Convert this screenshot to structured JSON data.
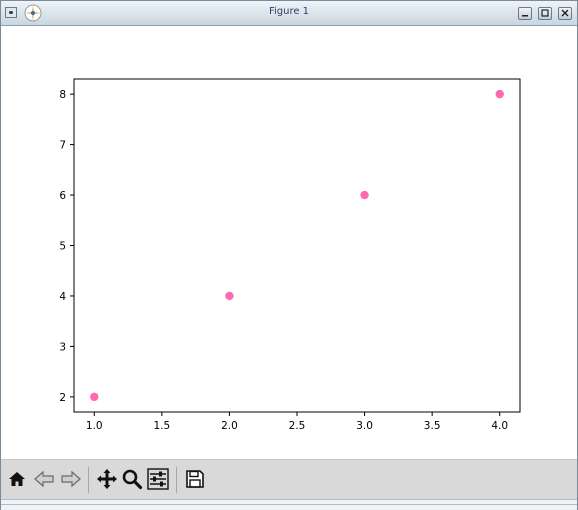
{
  "window": {
    "title": "Figure 1",
    "controls": {
      "minimize_icon": "minimize-icon",
      "maximize_icon": "maximize-icon",
      "close_icon": "close-icon"
    }
  },
  "toolbar": {
    "buttons": [
      {
        "id": "home",
        "icon": "home-icon"
      },
      {
        "id": "back",
        "icon": "arrow-left-icon"
      },
      {
        "id": "forward",
        "icon": "arrow-right-icon"
      },
      {
        "id": "pan",
        "icon": "move-icon"
      },
      {
        "id": "zoom",
        "icon": "magnifier-icon"
      },
      {
        "id": "configure",
        "icon": "sliders-icon"
      },
      {
        "id": "save",
        "icon": "floppy-disk-icon"
      }
    ]
  },
  "chart_data": {
    "type": "scatter",
    "x": [
      1.0,
      2.0,
      3.0,
      4.0
    ],
    "y": [
      2,
      4,
      6,
      8
    ],
    "title": "",
    "xlabel": "",
    "ylabel": "",
    "xlim": [
      0.85,
      4.15
    ],
    "ylim": [
      1.7,
      8.3
    ],
    "xticks": [
      "1.0",
      "1.5",
      "2.0",
      "2.5",
      "3.0",
      "3.5",
      "4.0"
    ],
    "yticks": [
      "2",
      "3",
      "4",
      "5",
      "6",
      "7",
      "8"
    ],
    "grid": false,
    "marker_color": "#ff69b4"
  }
}
